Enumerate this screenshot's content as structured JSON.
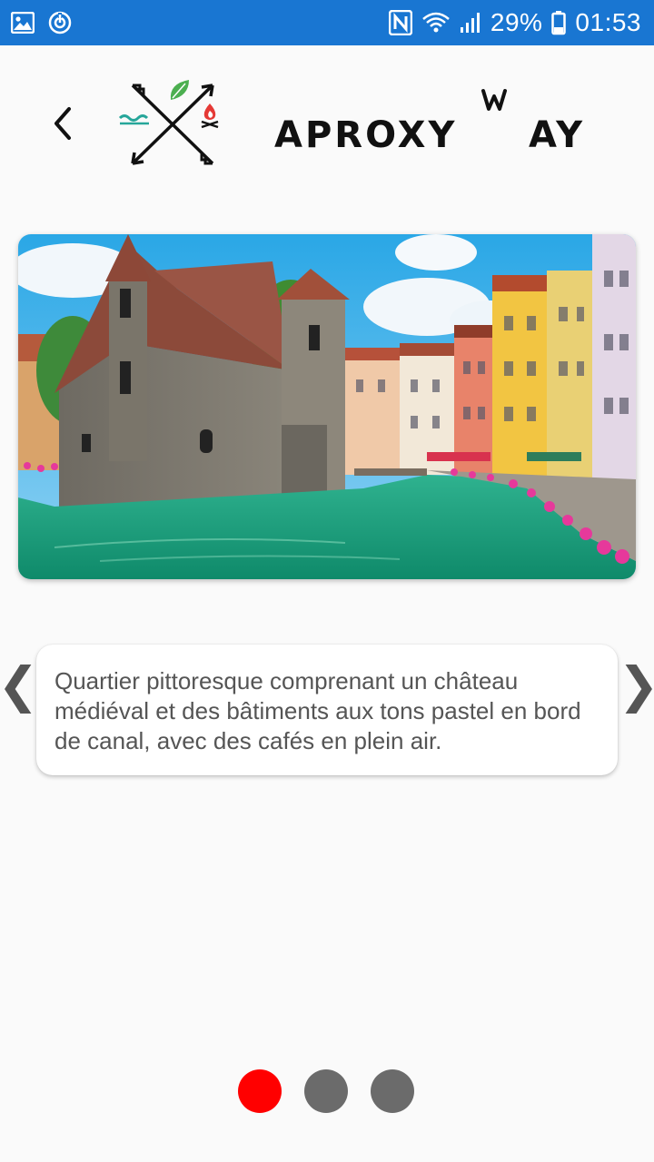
{
  "status_bar": {
    "battery_percent": "29%",
    "time": "01:53",
    "icons": [
      "gallery-icon",
      "sync-icon",
      "nfc-icon",
      "wifi-icon",
      "signal-icon",
      "battery-icon"
    ]
  },
  "header": {
    "back_icon": "chevron-left-icon",
    "logo_text": "APROXYWAY"
  },
  "slide": {
    "caption": "Quartier pittoresque comprenant un château médiéval et des bâtiments aux tons pastel en bord de canal, avec des cafés en plein air.",
    "prev_glyph": "❮",
    "next_glyph": "❯"
  },
  "pager": {
    "count": 3,
    "active_index": 0,
    "colors": {
      "active": "#ff0000",
      "inactive": "#6b6b6b"
    }
  },
  "colors": {
    "status_bar": "#1976d2",
    "background": "#fafafa",
    "caption_text": "#555555",
    "logo": "#111111",
    "leaf": "#4caf50",
    "flame": "#e53935",
    "water": "#26a69a"
  }
}
